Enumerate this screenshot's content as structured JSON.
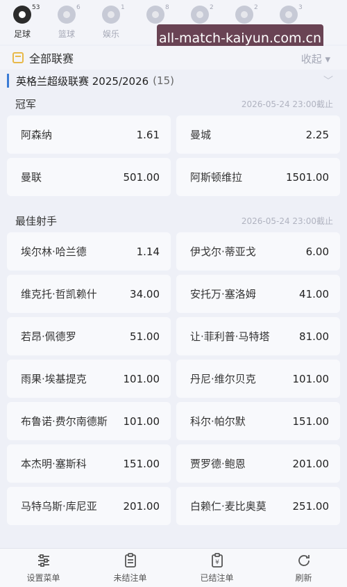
{
  "sports": [
    {
      "label": "足球",
      "count": "53",
      "icon": "soccer-ball-icon",
      "active": true
    },
    {
      "label": "篮球",
      "count": "6",
      "icon": "basketball-icon",
      "active": false
    },
    {
      "label": "娱乐",
      "count": "1",
      "icon": "camera-icon",
      "active": false
    },
    {
      "label": "",
      "count": "8",
      "icon": "tennis-ball-icon",
      "active": false
    },
    {
      "label": "",
      "count": "2",
      "icon": "ball-icon",
      "active": false
    },
    {
      "label": "",
      "count": "2",
      "icon": "ball-icon",
      "active": false
    },
    {
      "label": "",
      "count": "3",
      "icon": "ball-icon",
      "active": false
    }
  ],
  "watermark": "all-match-kaiyun.com.cn",
  "league_filter": {
    "title": "全部联赛",
    "collapse_label": "收起 ▾"
  },
  "league": {
    "name": "英格兰超级联赛 2025/2026",
    "count": "(15)"
  },
  "sections": [
    {
      "title": "冠军",
      "deadline": "2026-05-24 23:00截止",
      "items": [
        {
          "name": "阿森纳",
          "odds": "1.61"
        },
        {
          "name": "曼城",
          "odds": "2.25"
        },
        {
          "name": "曼联",
          "odds": "501.00"
        },
        {
          "name": "阿斯顿维拉",
          "odds": "1501.00"
        }
      ]
    },
    {
      "title": "最佳射手",
      "deadline": "2026-05-24 23:00截止",
      "items": [
        {
          "name": "埃尔林·哈兰德",
          "odds": "1.14"
        },
        {
          "name": "伊戈尔·蒂亚戈",
          "odds": "6.00"
        },
        {
          "name": "维克托·哲凯赖什",
          "odds": "34.00"
        },
        {
          "name": "安托万·塞洛姆",
          "odds": "41.00"
        },
        {
          "name": "若昂·佩德罗",
          "odds": "51.00"
        },
        {
          "name": "让·菲利普·马特塔",
          "odds": "81.00"
        },
        {
          "name": "雨果·埃基提克",
          "odds": "101.00"
        },
        {
          "name": "丹尼·维尔贝克",
          "odds": "101.00"
        },
        {
          "name": "布鲁诺·费尔南德斯",
          "odds": "101.00"
        },
        {
          "name": "科尔·帕尔默",
          "odds": "151.00"
        },
        {
          "name": "本杰明·塞斯科",
          "odds": "151.00"
        },
        {
          "name": "贾罗德·鲍恩",
          "odds": "201.00"
        },
        {
          "name": "马特乌斯·库尼亚",
          "odds": "201.00"
        },
        {
          "name": "白赖仁·麦比奥莫",
          "odds": "251.00"
        }
      ]
    }
  ],
  "bottom_nav": [
    {
      "label": "设置菜单",
      "icon": "sliders-icon"
    },
    {
      "label": "未结注单",
      "icon": "clipboard-icon"
    },
    {
      "label": "已结注单",
      "icon": "receipt-icon"
    },
    {
      "label": "刷新",
      "icon": "refresh-icon"
    }
  ]
}
